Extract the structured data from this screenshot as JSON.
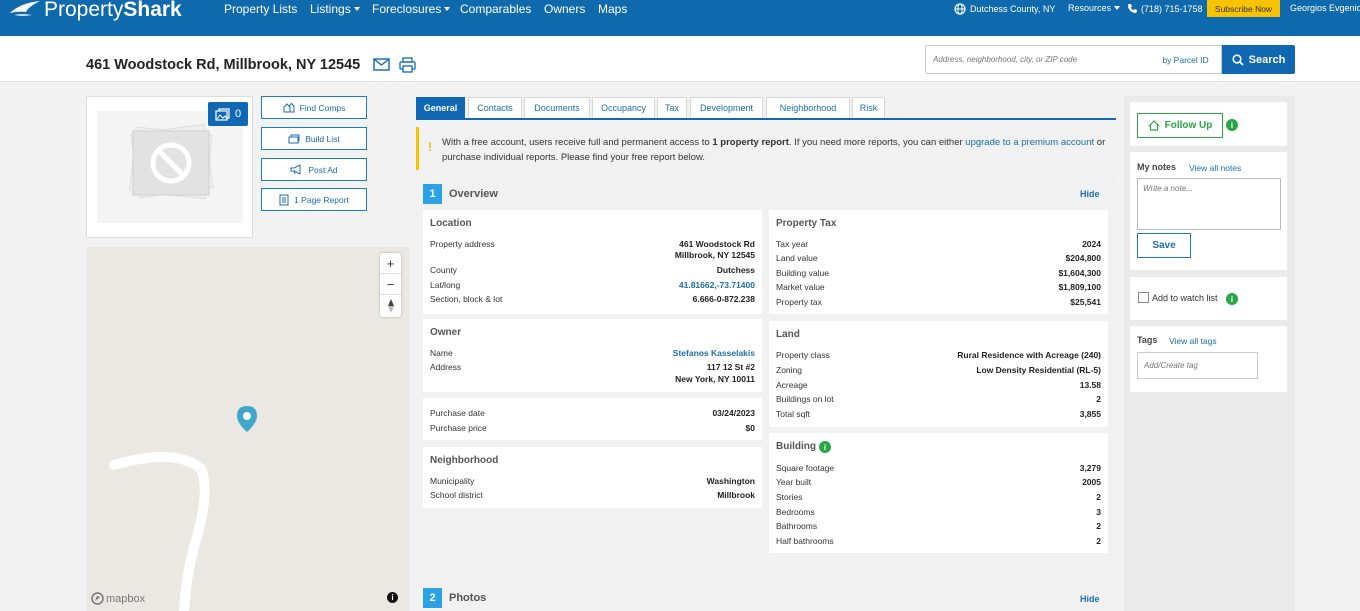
{
  "brand": {
    "light": "Property",
    "bold": "Shark"
  },
  "nav": {
    "property_lists": "Property Lists",
    "listings": "Listings",
    "foreclosures": "Foreclosures",
    "comparables": "Comparables",
    "owners": "Owners",
    "maps": "Maps",
    "location": "Dutchess County, NY",
    "resources": "Resources",
    "phone": "(718) 715-1758",
    "subscribe": "Subscribe Now",
    "user": "Georgios Evgenidis"
  },
  "header": {
    "address": "461 Woodstock Rd, Millbrook, NY 12545",
    "search_placeholder": "Address, neighborhood, city, or ZIP code",
    "parcel_label": "by Parcel ID",
    "search_label": "Search"
  },
  "photos": {
    "count": "0"
  },
  "side_buttons": {
    "find_comps": "Find Comps",
    "build_list": "Build List",
    "post_ad": "Post Ad",
    "one_page_report": "1 Page Report"
  },
  "map": {
    "attribution": "mapbox"
  },
  "tabs": [
    "General",
    "Contacts",
    "Documents",
    "Occupancy",
    "Tax",
    "Development",
    "Neighborhood",
    "Risk"
  ],
  "notice": {
    "text1": "With a free account, users receive full and permanent access to ",
    "bold": "1 property report",
    "text2": ". If you need more reports, you can either ",
    "link1": "upgrade to a premium account",
    "text3": " or purchase individual reports. Please find your free report below."
  },
  "overview": {
    "number": "1",
    "title": "Overview",
    "hide": "Hide",
    "location": {
      "title": "Location",
      "address_label": "Property address",
      "address_line1": "461 Woodstock Rd",
      "address_line2": "Millbrook, NY 12545",
      "county_label": "County",
      "county": "Dutchess",
      "latlong_label": "Lat/long",
      "latlong": "41.81662,-73.71400",
      "sbl_label": "Section, block & lot",
      "sbl": "6.666-0-872.238"
    },
    "owner": {
      "title": "Owner",
      "name_label": "Name",
      "name": "Stefanos Kasselakis",
      "address_label": "Address",
      "address_line1": "117 12 St #2",
      "address_line2": "New York, NY 10011"
    },
    "purchase": {
      "date_label": "Purchase date",
      "date": "03/24/2023",
      "price_label": "Purchase price",
      "price": "$0"
    },
    "neighborhood": {
      "title": "Neighborhood",
      "municipality_label": "Municipality",
      "municipality": "Washington",
      "school_label": "School district",
      "school": "Millbrook"
    },
    "property_tax": {
      "title": "Property Tax",
      "rows": [
        {
          "label": "Tax year",
          "value": "2024"
        },
        {
          "label": "Land value",
          "value": "$204,800"
        },
        {
          "label": "Building value",
          "value": "$1,604,300"
        },
        {
          "label": "Market value",
          "value": "$1,809,100"
        },
        {
          "label": "Property tax",
          "value": "$25,541"
        }
      ]
    },
    "land": {
      "title": "Land",
      "rows": [
        {
          "label": "Property class",
          "value": "Rural Residence with Acreage (240)"
        },
        {
          "label": "Zoning",
          "value": "Low Density Residential (RL-5)"
        },
        {
          "label": "Acreage",
          "value": "13.58"
        },
        {
          "label": "Buildings on lot",
          "value": "2"
        },
        {
          "label": "Total sqft",
          "value": "3,855"
        }
      ]
    },
    "building": {
      "title": "Building",
      "rows": [
        {
          "label": "Square footage",
          "value": "3,279"
        },
        {
          "label": "Year built",
          "value": "2005"
        },
        {
          "label": "Stories",
          "value": "2"
        },
        {
          "label": "Bedrooms",
          "value": "3"
        },
        {
          "label": "Bathrooms",
          "value": "2"
        },
        {
          "label": "Half bathrooms",
          "value": "2"
        }
      ]
    }
  },
  "photos_section": {
    "number": "2",
    "title": "Photos",
    "hide": "Hide"
  },
  "sidebar": {
    "follow_up": "Follow Up",
    "my_notes": "My notes",
    "view_all_notes": "View all notes",
    "note_placeholder": "Write a note...",
    "save": "Save",
    "watch_list": "Add to watch list",
    "tags": "Tags",
    "view_all_tags": "View all tags",
    "tag_placeholder": "Add/Create tag"
  },
  "colors": {
    "brand_blue": "#0f6aad",
    "accent_blue": "#1068b3",
    "section_num": "#29a3e6",
    "subscribe": "#f8c300",
    "follow_green": "#27a745"
  }
}
